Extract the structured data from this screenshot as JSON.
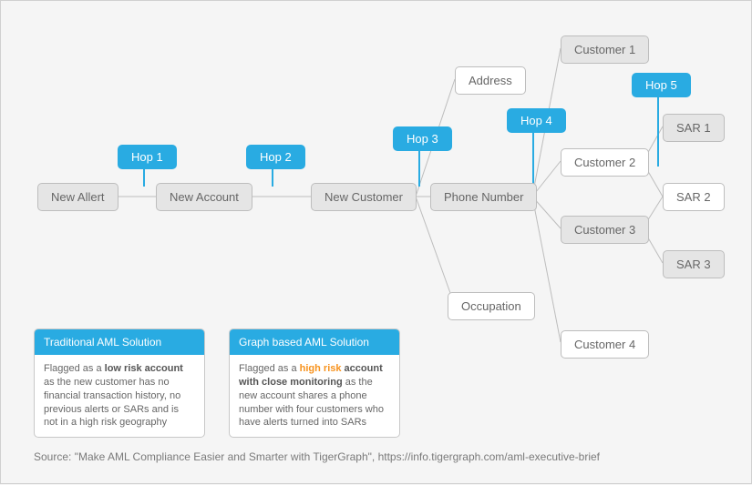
{
  "nodes": {
    "new_alert": "New Allert",
    "new_account": "New Account",
    "new_customer": "New Customer",
    "address": "Address",
    "phone_number": "Phone Number",
    "occupation": "Occupation",
    "customer1": "Customer 1",
    "customer2": "Customer 2",
    "customer3": "Customer 3",
    "customer4": "Customer 4",
    "sar1": "SAR 1",
    "sar2": "SAR 2",
    "sar3": "SAR 3"
  },
  "hops": {
    "hop1": "Hop 1",
    "hop2": "Hop 2",
    "hop3": "Hop 3",
    "hop4": "Hop 4",
    "hop5": "Hop 5"
  },
  "callouts": {
    "traditional": {
      "title": "Traditional AML Solution",
      "pre": "Flagged as a ",
      "bold": "low risk account",
      "post": " as the new customer has no financial transaction history, no previous alerts or SARs and is not in a high risk geography"
    },
    "graph": {
      "title": "Graph based AML Solution",
      "pre": "Flagged as a ",
      "highlight": "high risk",
      "bold": " account with close monitoring",
      "post": " as the new account shares a phone number with four customers who have alerts turned into SARs"
    }
  },
  "source": "Source: \"Make AML Compliance Easier and Smarter with TigerGraph\", https://info.tigergraph.com/aml-executive-brief"
}
